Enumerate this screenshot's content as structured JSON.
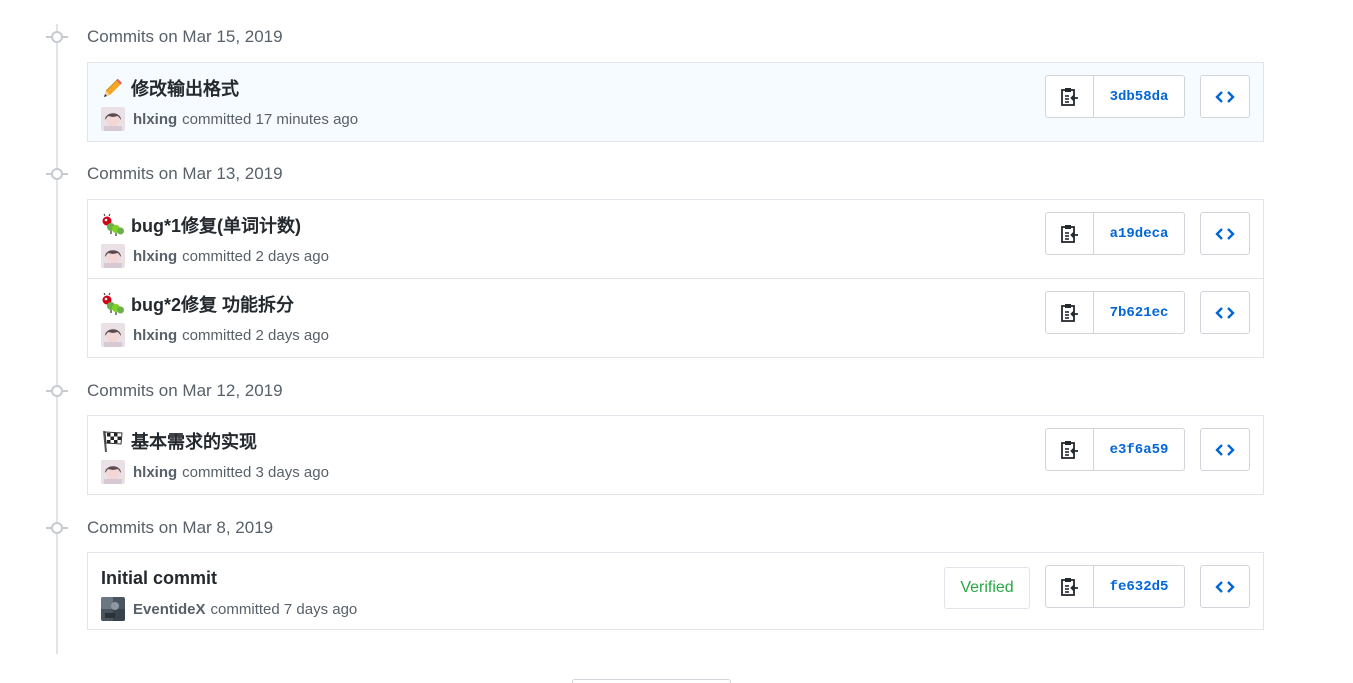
{
  "groups": [
    {
      "title": "Commits on Mar 15, 2019",
      "commits": [
        {
          "message": "修改输出格式",
          "emoji": "pencil-icon",
          "author": "hlxing",
          "time": "committed 17 minutes ago",
          "sha": "3db58da"
        }
      ]
    },
    {
      "title": "Commits on Mar 13, 2019",
      "commits": [
        {
          "message": "bug*1修复(单词计数)",
          "emoji": "bug-icon",
          "author": "hlxing",
          "time": "committed 2 days ago",
          "sha": "a19deca"
        },
        {
          "message": "bug*2修复 功能拆分",
          "emoji": "bug-icon",
          "author": "hlxing",
          "time": "committed 2 days ago",
          "sha": "7b621ec"
        }
      ]
    },
    {
      "title": "Commits on Mar 12, 2019",
      "commits": [
        {
          "message": "基本需求的实现",
          "emoji": "checkered-flag-icon",
          "author": "hlxing",
          "time": "committed 3 days ago",
          "sha": "e3f6a59"
        }
      ]
    },
    {
      "title": "Commits on Mar 8, 2019",
      "commits": [
        {
          "message": "Initial commit",
          "emoji": "",
          "author": "EventideX",
          "time": "committed 7 days ago",
          "sha": "fe632d5",
          "verified": "Verified"
        }
      ]
    }
  ],
  "colors": {
    "sha_link": "#0366d6",
    "verified": "#28a745",
    "highlight_bg": "#f6fbff"
  }
}
